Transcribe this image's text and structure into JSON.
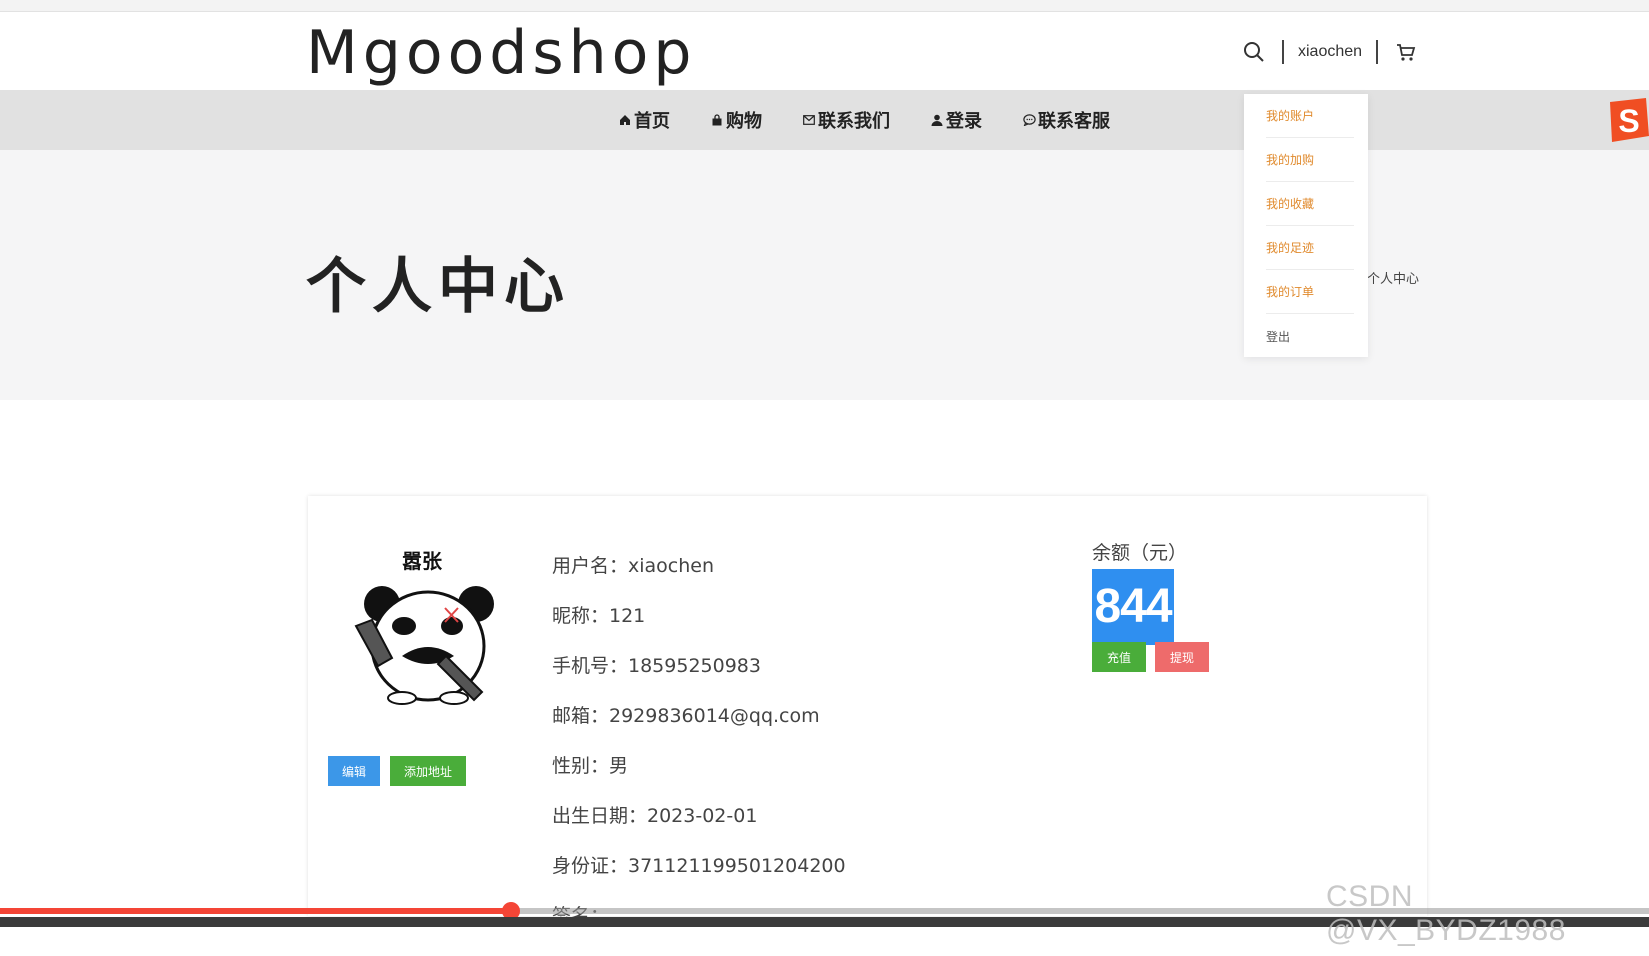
{
  "header": {
    "logo": "Mgoodshop",
    "username": "xiaochen"
  },
  "nav": {
    "items": [
      {
        "label": "首页",
        "icon": "home-icon"
      },
      {
        "label": "购物",
        "icon": "bag-icon"
      },
      {
        "label": "联系我们",
        "icon": "mail-icon"
      },
      {
        "label": "登录",
        "icon": "user-icon"
      },
      {
        "label": "联系客服",
        "icon": "chat-icon"
      }
    ]
  },
  "hero": {
    "title": "个人中心",
    "breadcrumb": "个人中心"
  },
  "dropdown": {
    "items": [
      "我的账户",
      "我的加购",
      "我的收藏",
      "我的足迹",
      "我的订单",
      "登出"
    ]
  },
  "profile": {
    "avatar_caption": "嚣张",
    "edit_label": "编辑",
    "add_address_label": "添加地址",
    "fields": [
      "用户名：xiaochen",
      "昵称：121",
      "手机号：18595250983",
      "邮箱：2929836014@qq.com",
      "性别：男",
      "出生日期：2023-02-01",
      "身份证：371121199501204200",
      "签名："
    ]
  },
  "balance": {
    "label": "余额（元）",
    "value": "844",
    "recharge_label": "充值",
    "withdraw_label": "提现"
  },
  "video": {
    "progress": 0.31
  },
  "watermark": "CSDN @VX_BYDZ1988",
  "colors": {
    "accent_blue": "#2f8ff0",
    "green": "#4aad3a",
    "red": "#ee6b6b",
    "dropdown_orange": "#e08a2d",
    "nav_bg": "#e1e1e1"
  }
}
